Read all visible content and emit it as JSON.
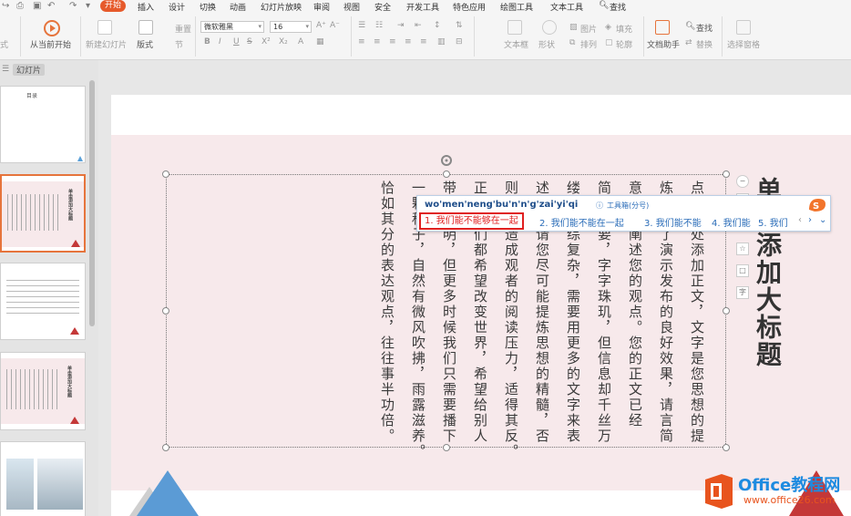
{
  "menu": {
    "tabs": [
      "开始",
      "插入",
      "设计",
      "切换",
      "动画",
      "幻灯片放映",
      "审阅",
      "视图",
      "安全",
      "开发工具",
      "特色应用",
      "绘图工具",
      "文本工具"
    ],
    "search": "查找"
  },
  "ribbon": {
    "partial_left": "式",
    "play_from_current": "从当前开始",
    "new_slide": "新建幻灯片",
    "layout": "版式",
    "reset": "重置",
    "section": "节",
    "font_name": "微软雅黑",
    "font_size": "16",
    "textbox": "文本框",
    "shape": "形状",
    "picture": "图片",
    "arrange": "排列",
    "fill": "填充",
    "outline": "轮廓",
    "doc_helper": "文档助手",
    "find": "查找",
    "replace": "替换",
    "select_pane": "选择窗格"
  },
  "left_panel": {
    "tab_label": "幻灯片",
    "thumb1_title": "目录",
    "thumb_title": "单击添加大标题"
  },
  "slide": {
    "title": "单击添加大标题",
    "columns": [
      "点击此处添加正文，文字是您思想的提",
      "炼，为了演示发布的良好效果，请言简",
      "意赅的阐述您的观点。您的正文已经",
      "简明扼要，字字珠玑，但信息却千丝万",
      "缕、错综复杂，需要用更多的文字来表",
      "述；但请您尽可能提炼思想的精髓，否",
      "则容易造成观者的阅读压力，适得其反。",
      "正如我们都希望改变世界，希望给别人",
      "带去光明，但更多时候我们只需要播下",
      "一颗种子，自然有微风吹拂，雨露滋养。",
      "恰如其分的表达观点，往往事半功倍。"
    ]
  },
  "ime": {
    "input": "wo'men'neng'bu'n'n'g'zai'yi'qi",
    "toolbox": "工具箱(分号)",
    "candidates": [
      "1. 我们能不能够在一起",
      "2. 我们能不能在一起",
      "3. 我们能不能",
      "4. 我们能",
      "5. 我们"
    ]
  },
  "watermark": {
    "brand": "Office教程网",
    "url": "www.office26.com"
  },
  "colors": {
    "accent": "#e65a2b",
    "pink": "#f7e9eb",
    "ime_blue": "#2a6cb8",
    "highlight_red": "#e02020"
  }
}
